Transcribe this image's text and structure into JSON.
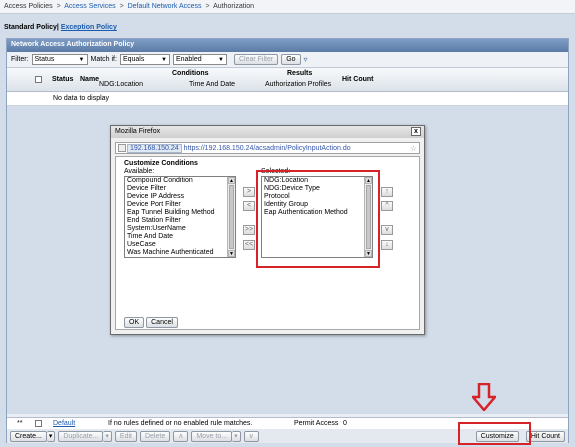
{
  "breadcrumb": {
    "items": [
      "Access Policies",
      "Access Services",
      "Default Network Access",
      "Authorization"
    ],
    "separator": ">"
  },
  "policy_tabs": {
    "standard": "Standard Policy|",
    "exception": "Exception Policy"
  },
  "panel": {
    "title": "Network Access Authorization Policy"
  },
  "filter": {
    "label": "Filter:",
    "field_value": "Status",
    "match_label": "Match if:",
    "operator_value": "Equals",
    "value_value": "Enabled",
    "clear_filter": "Clear Filter",
    "go": "Go",
    "dropdown_glyph": "▿"
  },
  "table": {
    "col_status": "Status",
    "col_name": "Name",
    "group_conditions": "Conditions",
    "col_ndg_location": "NDG:Location",
    "col_time_and_date": "Time And Date",
    "group_results": "Results",
    "col_authorization_profiles": "Authorization Profiles",
    "col_hit_count": "Hit Count",
    "no_data": "No data to display"
  },
  "default_row": {
    "marker": "**",
    "name": "Default",
    "conditions": "If no rules defined or no enabled rule matches.",
    "result": "Permit Access",
    "hit_count": "0"
  },
  "toolbar": {
    "create": "Create...",
    "duplicate": "Duplicate...",
    "edit": "Edit",
    "delete": "Delete",
    "move_to": "Move to...",
    "customize": "Customize",
    "hit_count": "Hit Count"
  },
  "dialog": {
    "title": "Mozilla Firefox",
    "close": "x",
    "url_site": "192.168.150.24",
    "url": "https://192.168.150.24/acsadmin/PolicyInputAction.do",
    "heading": "Customize Conditions",
    "available_label": "Available:",
    "selected_label": "Selected:",
    "available_items": [
      "Compound Condition",
      "Device Filter",
      "Device IP Address",
      "Device Port Filter",
      "Eap Tunnel Building Method",
      "End Station Filter",
      "System:UserName",
      "Time And Date",
      "UseCase",
      "Was Machine Authenticated"
    ],
    "selected_items": [
      "NDG:Location",
      "NDG:Device Type",
      "Protocol",
      "Identity Group",
      "Eap Authentication Method"
    ],
    "move_right": ">",
    "move_left": "<",
    "move_all_right": ">>",
    "move_all_left": "<<",
    "move_top": "↑",
    "move_up": "^",
    "move_down": "v",
    "move_bottom": "↓",
    "ok": "OK",
    "cancel": "Cancel"
  },
  "colors": {
    "highlight": "#d6232a",
    "link": "#1b5bb0",
    "header": "#5b7ba6"
  }
}
